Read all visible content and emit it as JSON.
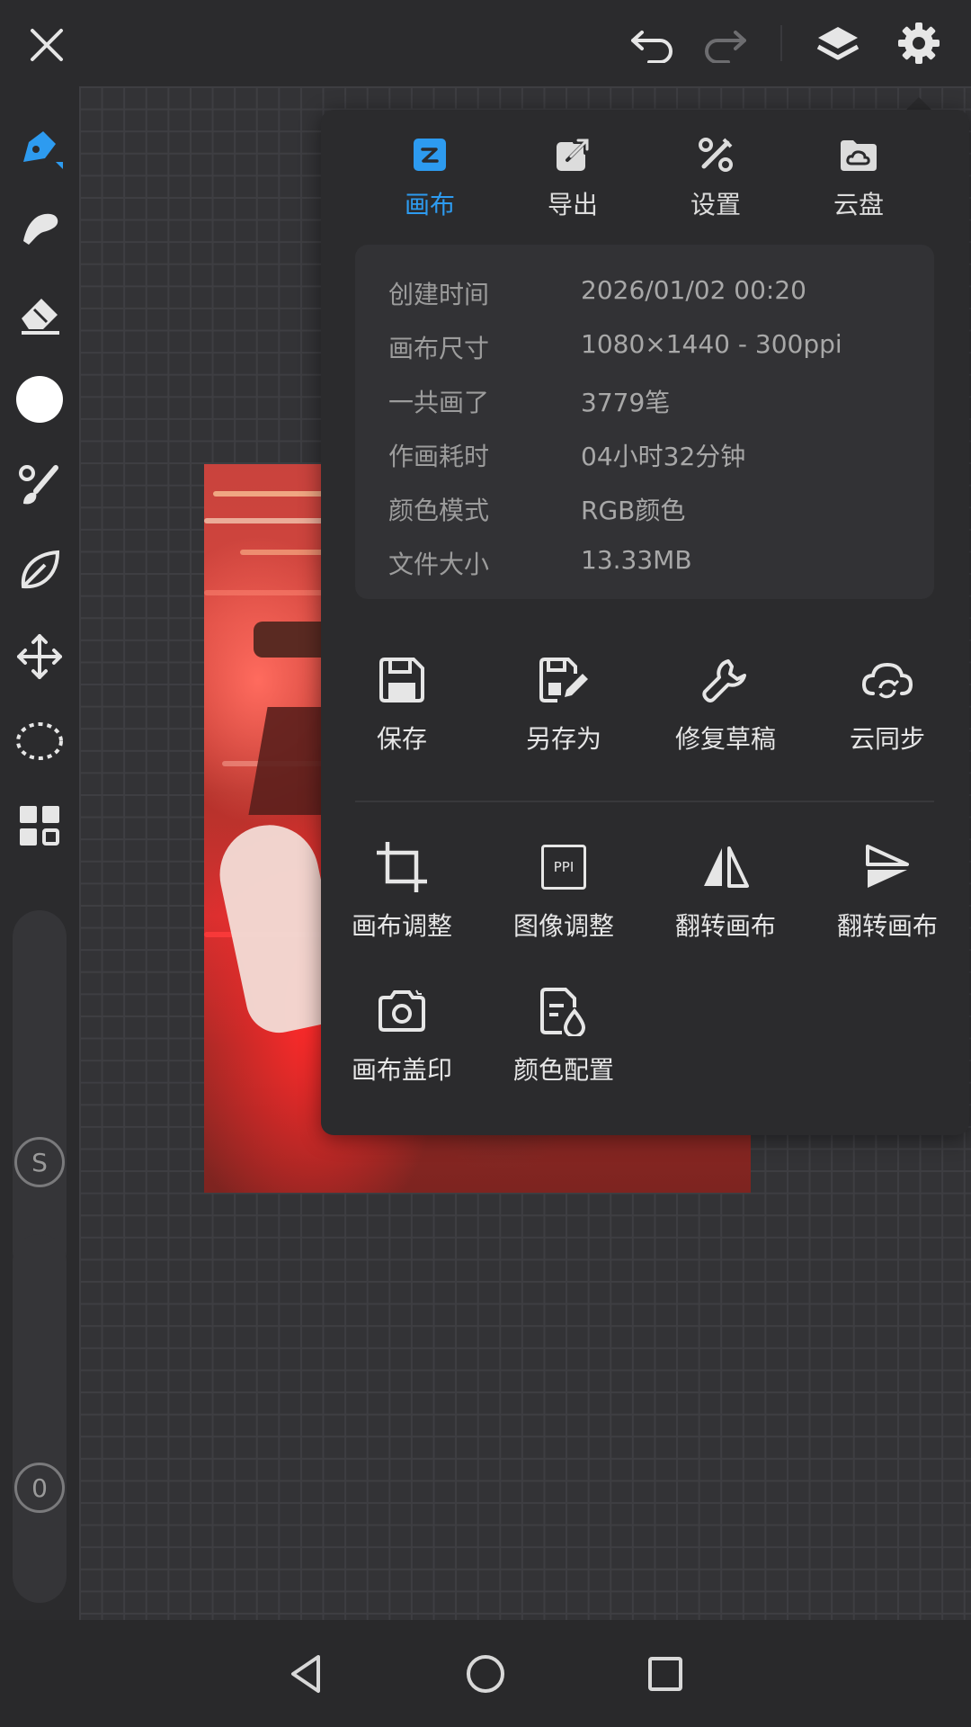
{
  "topbar": {
    "close_icon": "close-icon",
    "undo_icon": "undo-icon",
    "redo_icon": "redo-icon",
    "layers_icon": "layers-icon",
    "settings_icon": "gear-icon"
  },
  "toolbar": {
    "tools": [
      "pen-icon",
      "smudge-icon",
      "eraser-icon",
      "color-swatch",
      "brush-palette-icon",
      "leaf-icon",
      "move-icon",
      "lasso-icon",
      "grid-icon"
    ],
    "size_badge": "S",
    "opacity_badge": "0",
    "active_color": "#2d9bf0",
    "swatch_color": "#ffffff"
  },
  "panel": {
    "tabs": [
      {
        "label": "画布",
        "icon": "canvas-icon",
        "active": true
      },
      {
        "label": "导出",
        "icon": "export-icon",
        "active": false
      },
      {
        "label": "设置",
        "icon": "tools-icon",
        "active": false
      },
      {
        "label": "云盘",
        "icon": "cloud-drive-icon",
        "active": false
      }
    ],
    "info": [
      {
        "key": "创建时间",
        "value": "2026/01/02 00:20"
      },
      {
        "key": "画布尺寸",
        "value": "1080×1440 - 300ppi"
      },
      {
        "key": "一共画了",
        "value": "3779笔"
      },
      {
        "key": "作画耗时",
        "value": "04小时32分钟"
      },
      {
        "key": "颜色模式",
        "value": "RGB颜色"
      },
      {
        "key": "文件大小",
        "value": "13.33MB"
      }
    ],
    "actions_row1": [
      {
        "label": "保存",
        "icon": "save-icon"
      },
      {
        "label": "另存为",
        "icon": "save-as-icon"
      },
      {
        "label": "修复草稿",
        "icon": "wrench-icon"
      },
      {
        "label": "云同步",
        "icon": "cloud-sync-icon"
      }
    ],
    "actions_row2": [
      {
        "label": "画布调整",
        "icon": "crop-icon"
      },
      {
        "label": "图像调整",
        "icon": "ppi-icon",
        "icon_text": "PPI"
      },
      {
        "label": "翻转画布",
        "icon": "flip-horizontal-icon"
      },
      {
        "label": "翻转画布",
        "icon": "flip-vertical-icon"
      }
    ],
    "actions_row3": [
      {
        "label": "画布盖印",
        "icon": "camera-icon"
      },
      {
        "label": "颜色配置",
        "icon": "color-profile-icon"
      }
    ]
  },
  "navbar": {
    "back": "back-icon",
    "home": "home-icon",
    "recents": "recents-icon"
  }
}
